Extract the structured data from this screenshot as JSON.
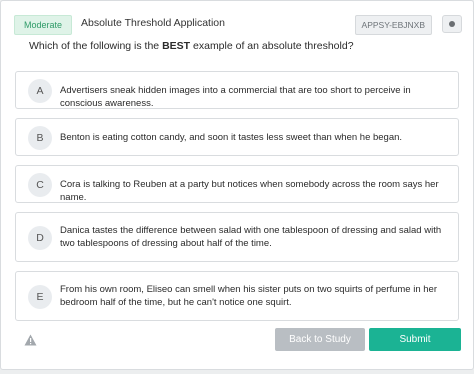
{
  "header": {
    "difficulty": "Moderate",
    "title": "Absolute Threshold Application",
    "code": "APPSY-EBJNXB"
  },
  "question": {
    "prefix": "Which of the following is the ",
    "emphasis": "BEST",
    "suffix": " example of an absolute threshold?"
  },
  "choices": [
    {
      "letter": "A",
      "text": "Advertisers sneak hidden images into a commercial that are too short to perceive in conscious awareness."
    },
    {
      "letter": "B",
      "text": "Benton is eating cotton candy, and soon it tastes less sweet than when he began."
    },
    {
      "letter": "C",
      "text": "Cora is talking to Reuben at a party but notices when somebody across the room says her name."
    },
    {
      "letter": "D",
      "text": "Danica tastes the difference between salad with one tablespoon of dressing and salad with two tablespoons of dressing about half of the time."
    },
    {
      "letter": "E",
      "text": "From his own room, Eliseo can smell when his sister puts on two squirts of perfume in her bedroom half of the time, but he can't notice one squirt."
    }
  ],
  "footer": {
    "back_label": "Back to Study Guide",
    "submit_label": "Submit"
  },
  "colors": {
    "accent": "#1bb394",
    "badge_bg": "#dff3e8",
    "badge_text": "#2f9b68",
    "disabled_button": "#b9bec3"
  },
  "icons": {
    "warning": "warning-triangle-icon",
    "options": "dot-icon"
  }
}
